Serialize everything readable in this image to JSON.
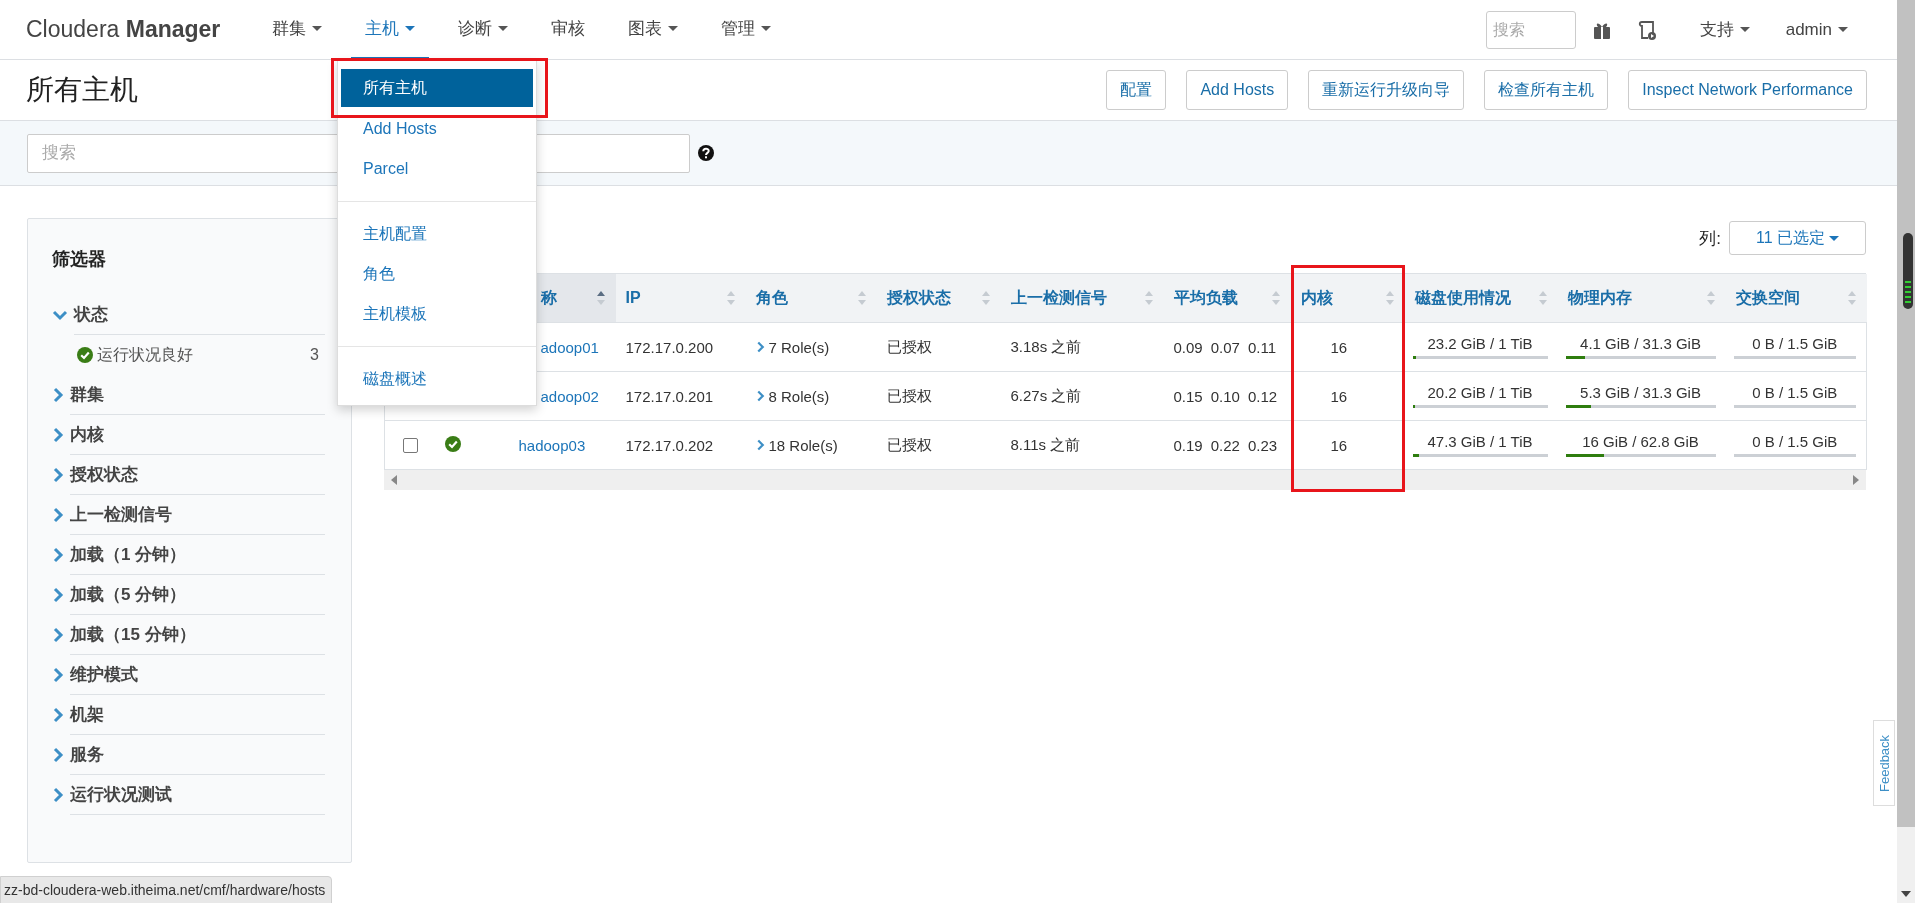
{
  "logo": "Cloudera **Manager**",
  "nav": [
    {
      "label": "群集",
      "dropdown": true,
      "selected": false
    },
    {
      "label": "主机",
      "dropdown": true,
      "selected": true
    },
    {
      "label": "诊断",
      "dropdown": true,
      "selected": false
    },
    {
      "label": "审核",
      "dropdown": false,
      "selected": false
    },
    {
      "label": "图表",
      "dropdown": true,
      "selected": false
    },
    {
      "label": "管理",
      "dropdown": true,
      "selected": false
    }
  ],
  "top_search": {
    "placeholder": "搜索"
  },
  "support": "支持",
  "user": "admin",
  "host_menu": [
    {
      "kind": "item",
      "label": "所有主机",
      "selected": true,
      "highlighted": true
    },
    {
      "kind": "item",
      "label": "Add Hosts",
      "selected": false,
      "highlighted": false
    },
    {
      "kind": "item",
      "label": "Parcel",
      "selected": false,
      "highlighted": false
    },
    {
      "kind": "divider"
    },
    {
      "kind": "item",
      "label": "主机配置",
      "selected": false,
      "highlighted": false
    },
    {
      "kind": "item",
      "label": "角色",
      "selected": false,
      "highlighted": false
    },
    {
      "kind": "item",
      "label": "主机模板",
      "selected": false,
      "highlighted": false
    },
    {
      "kind": "divider"
    },
    {
      "kind": "item",
      "label": "磁盘概述",
      "selected": false,
      "highlighted": false
    }
  ],
  "page_title": "所有主机",
  "actions": [
    "配置",
    "Add Hosts",
    "重新运行升级向导",
    "检查所有主机",
    "Inspect Network Performance"
  ],
  "filter_search": {
    "placeholder": "搜索"
  },
  "sidebar": {
    "title": "筛选器",
    "filters": [
      {
        "label": "状态",
        "expanded": true,
        "children": [
          {
            "label": "运行状况良好",
            "count": "3",
            "healthy": true
          }
        ]
      },
      {
        "label": "群集",
        "expanded": false
      },
      {
        "label": "内核",
        "expanded": false
      },
      {
        "label": "授权状态",
        "expanded": false
      },
      {
        "label": "上一检测信号",
        "expanded": false
      },
      {
        "label": "加载（1 分钟）",
        "expanded": false
      },
      {
        "label": "加载（5 分钟）",
        "expanded": false
      },
      {
        "label": "加载（15 分钟）",
        "expanded": false
      },
      {
        "label": "维护模式",
        "expanded": false
      },
      {
        "label": "机架",
        "expanded": false
      },
      {
        "label": "服务",
        "expanded": false
      },
      {
        "label": "运行状况测试",
        "expanded": false
      }
    ]
  },
  "column_picker": {
    "label": "列:",
    "value": "11 已选定"
  },
  "table": {
    "columns": [
      {
        "label": "称",
        "sorted": true,
        "highlighted": false
      },
      {
        "label": "IP",
        "sorted": false,
        "highlighted": false
      },
      {
        "label": "角色",
        "sorted": false,
        "highlighted": false
      },
      {
        "label": "授权状态",
        "sorted": false,
        "highlighted": false
      },
      {
        "label": "上一检测信号",
        "sorted": false,
        "highlighted": false
      },
      {
        "label": "平均负载",
        "sorted": false,
        "highlighted": false
      },
      {
        "label": "内核",
        "sorted": false,
        "highlighted": true
      },
      {
        "label": "磁盘使用情况",
        "sorted": false,
        "highlighted": false
      },
      {
        "label": "物理内存",
        "sorted": false,
        "highlighted": false
      },
      {
        "label": "交换空间",
        "sorted": false,
        "highlighted": false
      }
    ],
    "rows": [
      {
        "name": "adoop01",
        "ip": "172.17.0.200",
        "roles": "7 Role(s)",
        "authorization": "已授权",
        "heartbeat": "3.18s 之前",
        "load": [
          "0.09",
          "0.07",
          "0.11"
        ],
        "cores": "16",
        "disk": {
          "text": "23.2 GiB / 1 TiB",
          "level": 0.023
        },
        "memory": {
          "text": "4.1 GiB / 31.3 GiB",
          "level": 0.13
        },
        "swap": {
          "text": "0 B / 1.5 GiB",
          "level": 0
        }
      },
      {
        "name": "adoop02",
        "ip": "172.17.0.201",
        "roles": "8 Role(s)",
        "authorization": "已授权",
        "heartbeat": "6.27s 之前",
        "load": [
          "0.15",
          "0.10",
          "0.12"
        ],
        "cores": "16",
        "disk": {
          "text": "20.2 GiB / 1 TiB",
          "level": 0.02
        },
        "memory": {
          "text": "5.3 GiB / 31.3 GiB",
          "level": 0.17
        },
        "swap": {
          "text": "0 B / 1.5 GiB",
          "level": 0
        }
      },
      {
        "checked": false,
        "healthy": true,
        "name": "hadoop03",
        "ip": "172.17.0.202",
        "roles": "18 Role(s)",
        "authorization": "已授权",
        "heartbeat": "8.11s 之前",
        "load": [
          "0.19",
          "0.22",
          "0.23"
        ],
        "cores": "16",
        "disk": {
          "text": "47.3 GiB / 1 TiB",
          "level": 0.046
        },
        "memory": {
          "text": "16 GiB / 62.8 GiB",
          "level": 0.255
        },
        "swap": {
          "text": "0 B / 1.5 GiB",
          "level": 0
        }
      }
    ]
  },
  "status_url": "zz-bd-cloudera-web.itheima.net/cmf/hardware/hosts",
  "feedback": "Feedback"
}
